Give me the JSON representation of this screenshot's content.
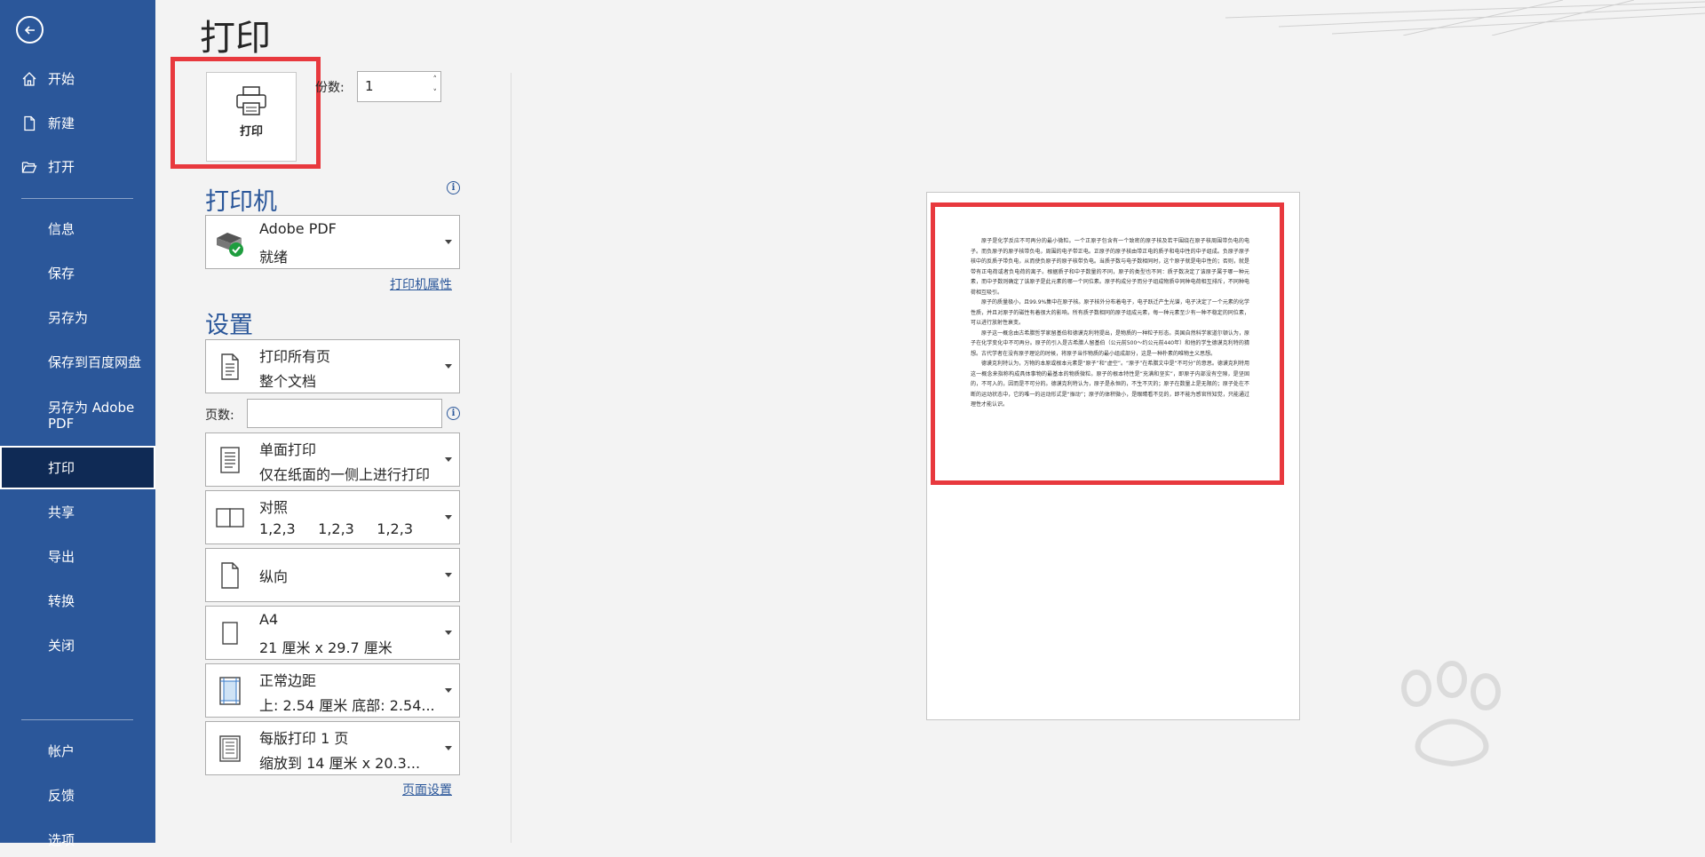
{
  "sidebar": {
    "items": [
      {
        "label": "开始",
        "icon": "home-icon"
      },
      {
        "label": "新建",
        "icon": "new-document-icon"
      },
      {
        "label": "打开",
        "icon": "open-folder-icon"
      },
      {
        "label": "信息"
      },
      {
        "label": "保存"
      },
      {
        "label": "另存为"
      },
      {
        "label": "保存到百度网盘"
      },
      {
        "label": "另存为 Adobe PDF"
      },
      {
        "label": "打印",
        "active": true
      },
      {
        "label": "共享"
      },
      {
        "label": "导出"
      },
      {
        "label": "转换"
      },
      {
        "label": "关闭"
      },
      {
        "label": "帐户"
      },
      {
        "label": "反馈"
      },
      {
        "label": "选项"
      }
    ]
  },
  "page": {
    "title": "打印"
  },
  "print_button": {
    "label": "打印"
  },
  "copies": {
    "label": "份数:",
    "value": "1"
  },
  "printer": {
    "heading": "打印机",
    "name": "Adobe PDF",
    "status": "就绪",
    "properties_link": "打印机属性"
  },
  "settings": {
    "heading": "设置",
    "range": {
      "line1": "打印所有页",
      "line2": "整个文档"
    },
    "pages_label": "页数:",
    "sides": {
      "line1": "单面打印",
      "line2": "仅在纸面的一侧上进行打印"
    },
    "collate": {
      "line1": "对照",
      "line2": "1,2,3     1,2,3     1,2,3"
    },
    "orientation": {
      "line1": "纵向"
    },
    "paper": {
      "line1": "A4",
      "line2": "21 厘米 x 29.7 厘米"
    },
    "margins": {
      "line1": "正常边距",
      "line2": "上: 2.54 厘米 底部: 2.54..."
    },
    "per_sheet": {
      "line1": "每版打印 1 页",
      "line2": "缩放到 14 厘米 x 20.3..."
    },
    "page_setup_link": "页面设置"
  },
  "preview": {
    "paragraphs": [
      "原子是化学反应不可再分的最小微粒。一个正原子包含有一个致密的原子核及若干围绕在原子核周围带负电的电子。而负原子的原子核带负电，周围的电子带正电。正原子的原子核由带正电的质子和电中性的中子组成。负原子原子核中的反质子带负电，从而使负原子的原子核带负电。当质子数与电子数相同时，这个原子就是电中性的；否则，就是带有正电荷或者负电荷的离子。根据质子和中子数量的不同，原子的类型也不同：质子数决定了该原子属于哪一种元素，而中子数则确定了该原子是此元素的哪一个同位素。原子构成分子而分子组成物质中同种电荷相互排斥，不同种电荷相互吸引。",
      "原子的质量极小，且99.9%集中在原子核。原子核外分布着电子，电子跃迁产生光谱，电子决定了一个元素的化学性质，并且对原子的磁性有着很大的影响。所有质子数相同的原子组成元素，每一种元素至少有一种不稳定的同位素，可以进行放射性衰变。",
      "原子这一概念由古希腊哲学家留基伯和德谟克利特提出，是物质的一种粒子形态。英国自然科学家道尔顿认为，原子在化学变化中不可再分。原子的引入是古希腊人留基伯（公元前500～约公元前440年）和他的学生德谟克利特的猜想。古代学者在没有原子理论的时候，将原子当作物质的最小组成部分，这是一种朴素的唯物主义思想。",
      "德谟克利特认为，万物的本原或根本元素是“原子”和“虚空”。“原子”在希腊文中是“不可分”的意思。德谟克利特用这一概念来指称构成具体事物的最基本的物质微粒。原子的根本特性是“充满和坚实”，即原子内部没有空隙，是坚固的，不可入的，因而是不可分的。德谟克利特认为，原子是永恒的，不生不灭的；原子在数量上是无限的；原子处在不断的运动状态中，它的唯一的运动形式是“振动”；原子的体积微小，是眼睛看不见的，即不能为感官所知觉，只能通过理性才能认识。"
    ]
  },
  "colors": {
    "accent": "#2b579a",
    "active_nav": "#0f2a55",
    "highlight": "#e8393e"
  }
}
